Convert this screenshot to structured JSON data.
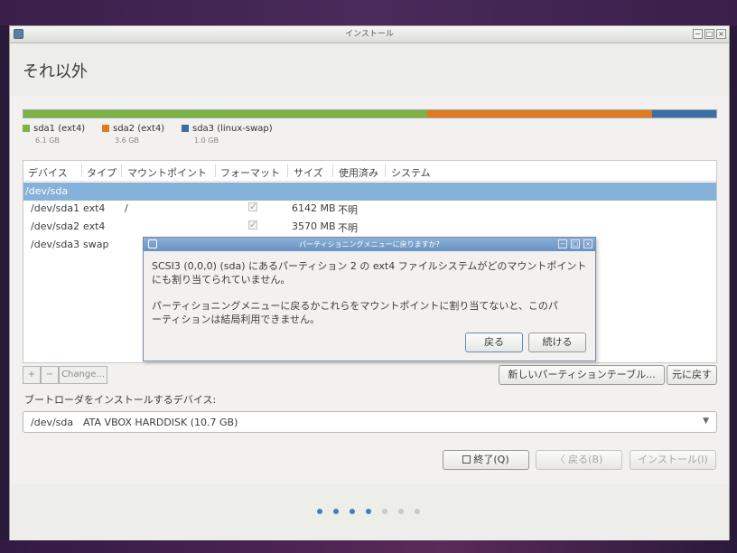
{
  "window": {
    "title": "インストール",
    "page_title": "それ以外",
    "min_glyph": "−",
    "max_glyph": "□",
    "close_glyph": "×"
  },
  "partition_bar": [
    {
      "name": "sda1 (ext4)",
      "size": "6.1 GB",
      "color": "#7cb342",
      "share": 0.6
    },
    {
      "name": "sda2 (ext4)",
      "size": "3.6 GB",
      "color": "#e07b20",
      "share": 0.335
    },
    {
      "name": "sda3 (linux-swap)",
      "size": "1.0 GB",
      "color": "#3a6ea5",
      "share": 0.095
    }
  ],
  "table": {
    "headers": [
      "デバイス",
      "タイプ",
      "マウントポイント",
      "フォーマット",
      "サイズ",
      "使用済み",
      "システム"
    ],
    "disk_row": "/dev/sda",
    "rows": [
      {
        "device": "/dev/sda1",
        "type": "ext4",
        "mount": "/",
        "format": true,
        "size": "6142 MB",
        "used": "不明"
      },
      {
        "device": "/dev/sda2",
        "type": "ext4",
        "mount": "",
        "format": true,
        "size": "3570 MB",
        "used": "不明"
      },
      {
        "device": "/dev/sda3",
        "type": "swap",
        "mount": "",
        "format": false,
        "size": "",
        "used": ""
      }
    ],
    "check_glyph": "✓"
  },
  "table_buttons": {
    "add": "+",
    "remove": "−",
    "change": "Change...",
    "new_table": "新しいパーティションテーブル...",
    "revert": "元に戻す"
  },
  "bootloader": {
    "label": "ブートローダをインストールするデバイス:",
    "device": "/dev/sda",
    "description": "ATA VBOX HARDDISK (10.7 GB)",
    "arrow": "▼"
  },
  "nav": {
    "quit": "終了(Q)",
    "back": "〈 戻る(B)",
    "install": "インストール(I)"
  },
  "progress": {
    "total_steps": 7,
    "completed_steps": 4,
    "active_color": "#4a7ab8",
    "inactive_color": "#c8c8c4"
  },
  "dialog": {
    "title": "パーティショニングメニューに戻りますか?",
    "line1": "SCSI3 (0,0,0) (sda) にあるパーティション 2 の ext4 ファイルシステムがどのマウントポイント",
    "line2": "にも割り当てられていません。",
    "line3": "パーティショニングメニューに戻るかこれらをマウントポイントに割り当てないと、このパ",
    "line4": "ーティションは結局利用できません。",
    "back_button": "戻る",
    "continue_button": "続ける"
  }
}
